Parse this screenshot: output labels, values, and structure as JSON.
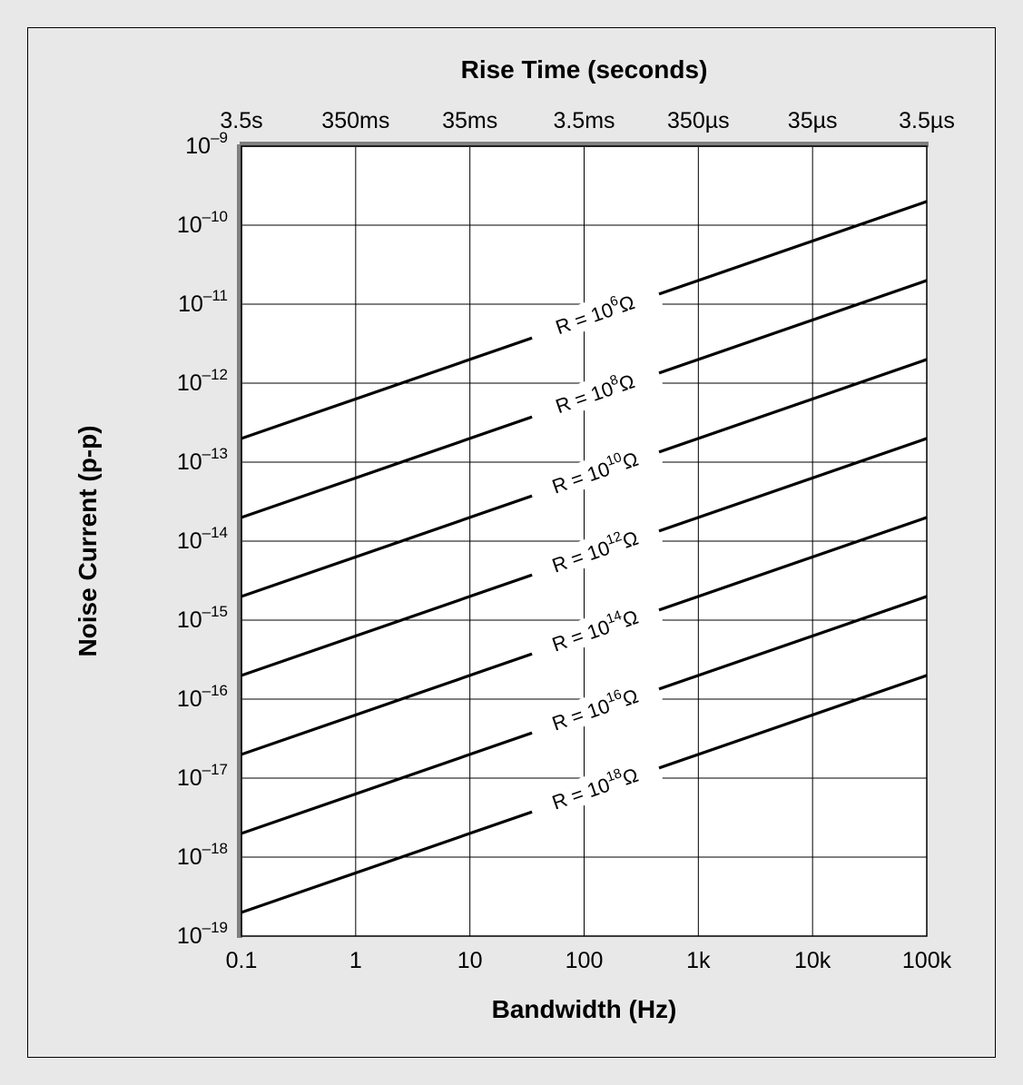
{
  "chart_data": {
    "type": "line",
    "title_top": "Rise Time (seconds)",
    "title_bottom": "Bandwidth (Hz)",
    "title_y": "Noise Current (p-p)",
    "x_axis": {
      "log_min": -1,
      "log_max": 5,
      "ticks": [
        {
          "logv": -1,
          "label": "0.1",
          "top_label": "3.5s"
        },
        {
          "logv": 0,
          "label": "1",
          "top_label": "350ms"
        },
        {
          "logv": 1,
          "label": "10",
          "top_label": "35ms"
        },
        {
          "logv": 2,
          "label": "100",
          "top_label": "3.5ms"
        },
        {
          "logv": 3,
          "label": "1k",
          "top_label": "350µs"
        },
        {
          "logv": 4,
          "label": "10k",
          "top_label": "35µs"
        },
        {
          "logv": 5,
          "label": "100k",
          "top_label": "3.5µs"
        }
      ]
    },
    "y_axis": {
      "log_min": -19,
      "log_max": -9,
      "ticks": [
        {
          "logv": -9,
          "label_base": "10",
          "label_exp": "–9"
        },
        {
          "logv": -10,
          "label_base": "10",
          "label_exp": "–10"
        },
        {
          "logv": -11,
          "label_base": "10",
          "label_exp": "–11"
        },
        {
          "logv": -12,
          "label_base": "10",
          "label_exp": "–12"
        },
        {
          "logv": -13,
          "label_base": "10",
          "label_exp": "–13"
        },
        {
          "logv": -14,
          "label_base": "10",
          "label_exp": "–14"
        },
        {
          "logv": -15,
          "label_base": "10",
          "label_exp": "–15"
        },
        {
          "logv": -16,
          "label_base": "10",
          "label_exp": "–16"
        },
        {
          "logv": -17,
          "label_base": "10",
          "label_exp": "–17"
        },
        {
          "logv": -18,
          "label_base": "10",
          "label_exp": "–18"
        },
        {
          "logv": -19,
          "label_base": "10",
          "label_exp": "–19"
        }
      ]
    },
    "series": [
      {
        "name": "R = 10^6 Ω",
        "label_prefix": "R = 10",
        "label_exp": "6",
        "label_suffix": "Ω",
        "p1": {
          "xlog": -1,
          "ylog": -12.7
        },
        "p2": {
          "xlog": 5,
          "ylog": -9.7
        }
      },
      {
        "name": "R = 10^8 Ω",
        "label_prefix": "R = 10",
        "label_exp": "8",
        "label_suffix": "Ω",
        "p1": {
          "xlog": -1,
          "ylog": -13.7
        },
        "p2": {
          "xlog": 5,
          "ylog": -10.7
        }
      },
      {
        "name": "R = 10^10 Ω",
        "label_prefix": "R = 10",
        "label_exp": "10",
        "label_suffix": "Ω",
        "p1": {
          "xlog": -1,
          "ylog": -14.7
        },
        "p2": {
          "xlog": 5,
          "ylog": -11.7
        }
      },
      {
        "name": "R = 10^12 Ω",
        "label_prefix": "R = 10",
        "label_exp": "12",
        "label_suffix": "Ω",
        "p1": {
          "xlog": -1,
          "ylog": -15.7
        },
        "p2": {
          "xlog": 5,
          "ylog": -12.7
        }
      },
      {
        "name": "R = 10^14 Ω",
        "label_prefix": "R = 10",
        "label_exp": "14",
        "label_suffix": "Ω",
        "p1": {
          "xlog": -1,
          "ylog": -16.7
        },
        "p2": {
          "xlog": 5,
          "ylog": -13.7
        }
      },
      {
        "name": "R = 10^16 Ω",
        "label_prefix": "R = 10",
        "label_exp": "16",
        "label_suffix": "Ω",
        "p1": {
          "xlog": -1,
          "ylog": -17.7
        },
        "p2": {
          "xlog": 5,
          "ylog": -14.7
        }
      },
      {
        "name": "R = 10^18 Ω",
        "label_prefix": "R = 10",
        "label_exp": "18",
        "label_suffix": "Ω",
        "p1": {
          "xlog": -1,
          "ylog": -18.7
        },
        "p2": {
          "xlog": 5,
          "ylog": -15.7
        }
      }
    ]
  }
}
